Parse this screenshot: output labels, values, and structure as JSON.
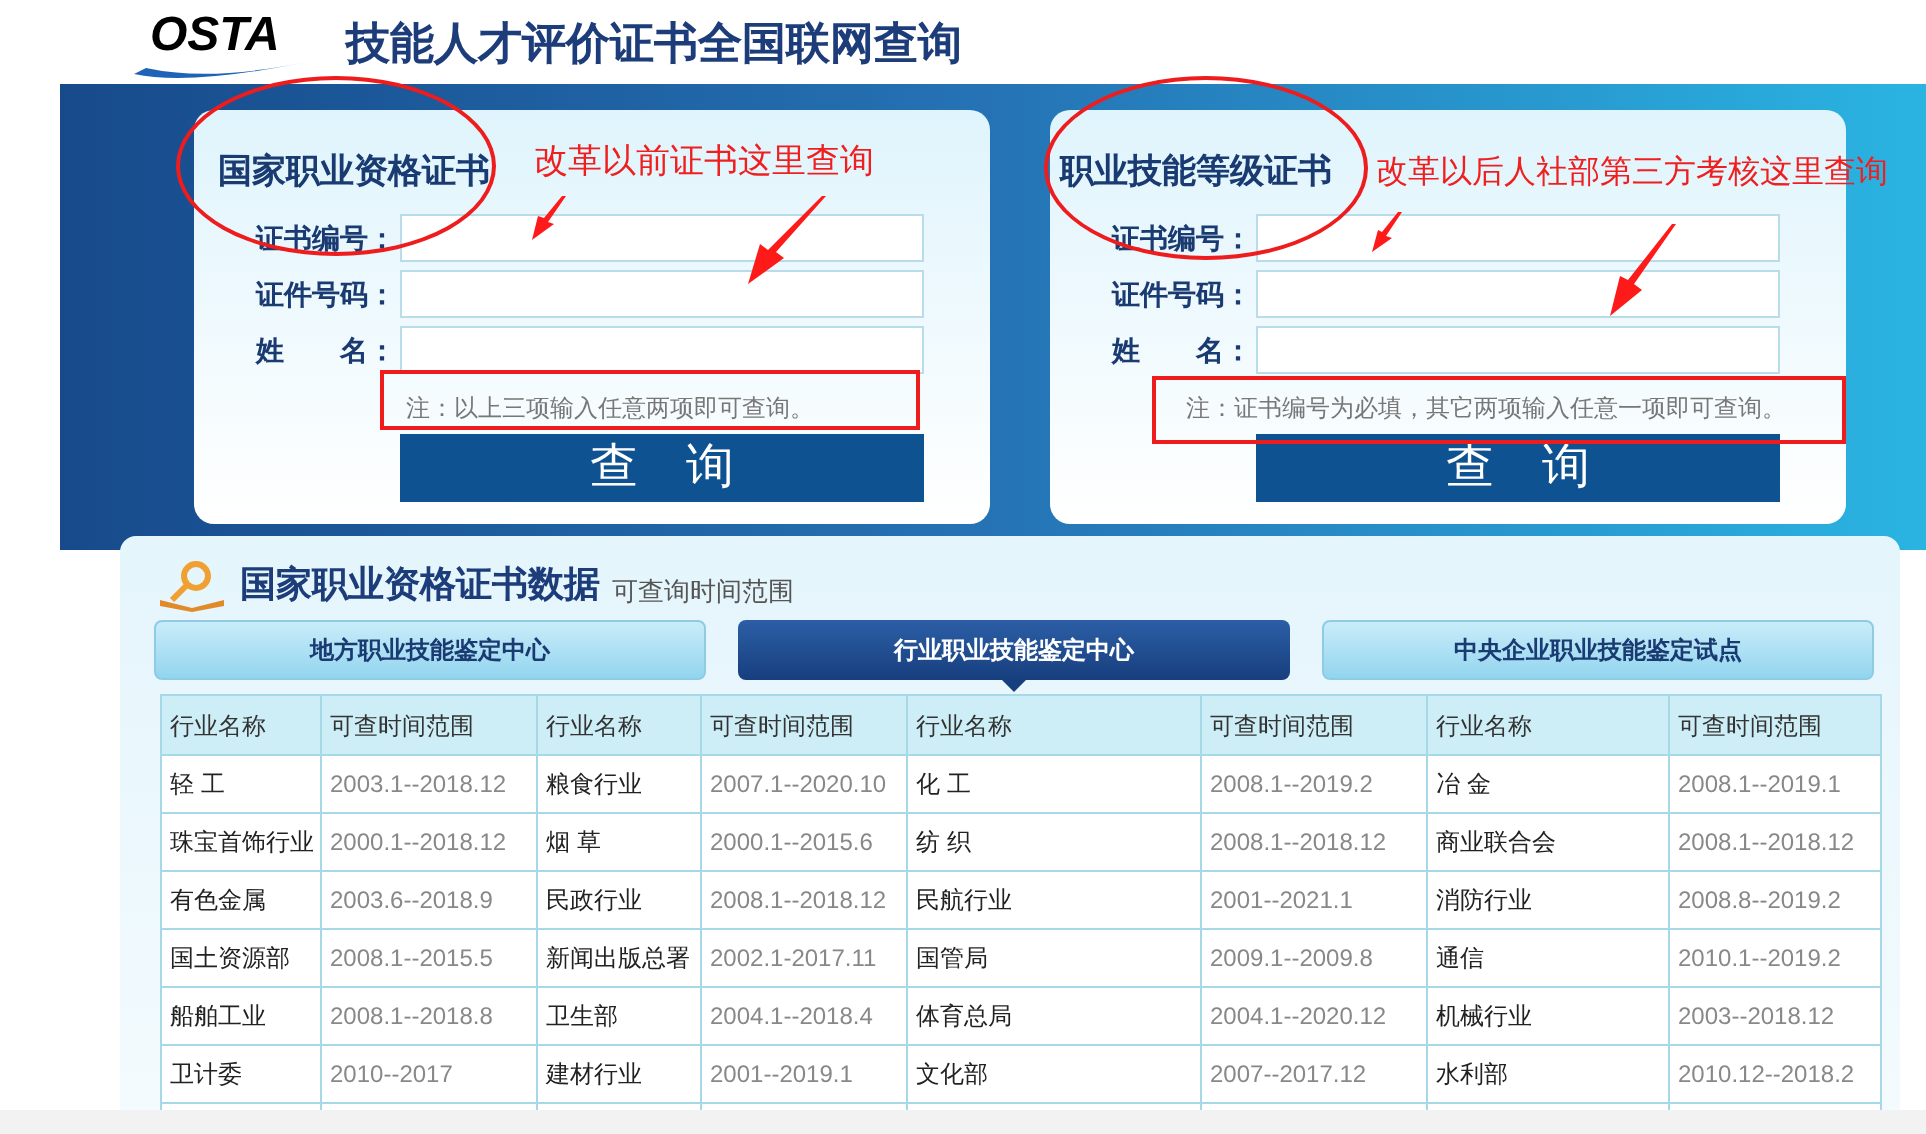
{
  "header": {
    "logo": "OSTA",
    "title": "技能人才评价证书全国联网查询"
  },
  "cards": [
    {
      "title": "国家职业资格证书",
      "fields": [
        {
          "label": "证书编号："
        },
        {
          "label": "证件号码："
        },
        {
          "label": "姓　　名："
        }
      ],
      "note": "注：以上三项输入任意两项即可查询。",
      "button": "查　询",
      "annotation": "改革以前证书这里查询"
    },
    {
      "title": "职业技能等级证书",
      "fields": [
        {
          "label": "证书编号："
        },
        {
          "label": "证件号码："
        },
        {
          "label": "姓　　名："
        }
      ],
      "note": "注：证书编号为必填，其它两项输入任意一项即可查询。",
      "button": "查　询",
      "annotation": "改革以后人社部第三方考核这里查询"
    }
  ],
  "data_panel": {
    "title": "国家职业资格证书数据",
    "subtitle": "可查询时间范围",
    "tabs": [
      {
        "label": "地方职业技能鉴定中心",
        "selected": false
      },
      {
        "label": "行业职业技能鉴定中心",
        "selected": true
      },
      {
        "label": "中央企业职业技能鉴定试点",
        "selected": false
      }
    ],
    "table": {
      "columns": [
        "行业名称",
        "可查时间范围",
        "行业名称",
        "可查时间范围",
        "行业名称",
        "可查时间范围",
        "行业名称",
        "可查时间范围"
      ],
      "rows": [
        [
          "轻 工",
          "2003.1--2018.12",
          "粮食行业",
          "2007.1--2020.10",
          "化 工",
          "2008.1--2019.2",
          "冶 金",
          "2008.1--2019.1"
        ],
        [
          "珠宝首饰行业",
          "2000.1--2018.12",
          "烟 草",
          "2000.1--2015.6",
          "纺 织",
          "2008.1--2018.12",
          "商业联合会",
          "2008.1--2018.12"
        ],
        [
          "有色金属",
          "2003.6--2018.9",
          "民政行业",
          "2008.1--2018.12",
          "民航行业",
          "2001--2021.1",
          "消防行业",
          "2008.8--2019.2"
        ],
        [
          "国土资源部",
          "2008.1--2015.5",
          "新闻出版总署",
          "2002.1-2017.11",
          "国管局",
          "2009.1--2009.8",
          "通信",
          "2010.1--2019.2"
        ],
        [
          "船舶工业",
          "2008.1--2018.8",
          "卫生部",
          "2004.1--2018.4",
          "体育总局",
          "2004.1--2020.12",
          "机械行业",
          "2003--2018.12"
        ],
        [
          "卫计委",
          "2010--2017",
          "建材行业",
          "2001--2019.1",
          "文化部",
          "2007--2017.12",
          "水利部",
          "2010.12--2018.2"
        ]
      ]
    }
  }
}
